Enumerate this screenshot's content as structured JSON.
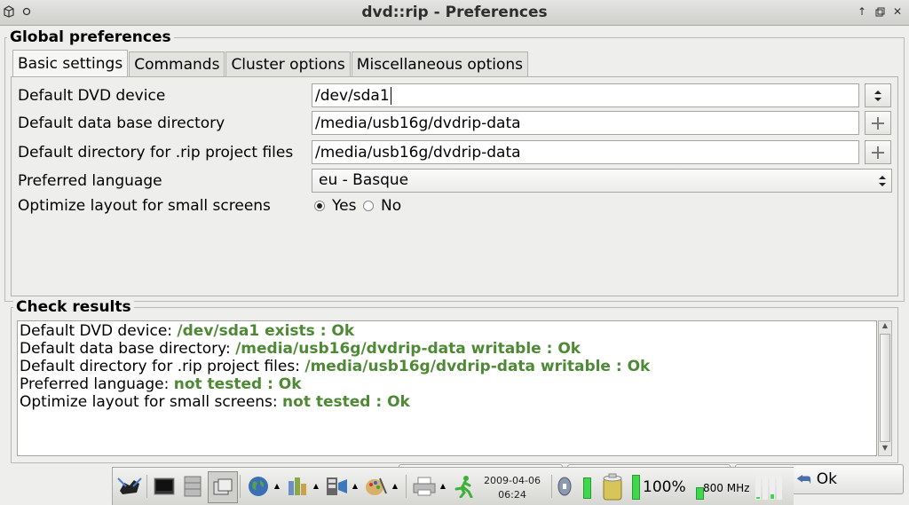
{
  "window": {
    "title": "dvd::rip - Preferences"
  },
  "global_frame": {
    "legend": "Global preferences"
  },
  "tabs": [
    "Basic settings",
    "Commands",
    "Cluster options",
    "Miscellaneous options"
  ],
  "settings": {
    "dvd_device": {
      "label": "Default DVD device",
      "value": "/dev/sda1"
    },
    "data_dir": {
      "label": "Default data base directory",
      "value": "/media/usb16g/dvdrip-data"
    },
    "project_dir": {
      "label": "Default directory for .rip project files",
      "value": "/media/usb16g/dvdrip-data"
    },
    "language": {
      "label": "Preferred language",
      "value": "eu - Basque"
    },
    "small_screens": {
      "label": "Optimize layout for small screens",
      "yes": "Yes",
      "no": "No",
      "selected": "Yes"
    }
  },
  "check": {
    "legend": "Check results",
    "lines": [
      {
        "label": "Default DVD device: ",
        "value": "/dev/sda1 exists : Ok"
      },
      {
        "label": "Default data base directory: ",
        "value": "/media/usb16g/dvdrip-data writable : Ok"
      },
      {
        "label": "Default directory for .rip project files: ",
        "value": "/media/usb16g/dvdrip-data writable : Ok"
      },
      {
        "label": "Preferred language: ",
        "value": "not tested : Ok"
      },
      {
        "label": "Optimize layout for small screens: ",
        "value": "not tested : Ok"
      }
    ]
  },
  "buttons": {
    "ok": "Ok"
  },
  "taskbar": {
    "date": "2009-04-06",
    "time": "06:24",
    "battery": "100%",
    "cpu": "800 MHz",
    "colors": {
      "meter": "#3fd84b",
      "ok_text": "#4e8a36"
    }
  }
}
